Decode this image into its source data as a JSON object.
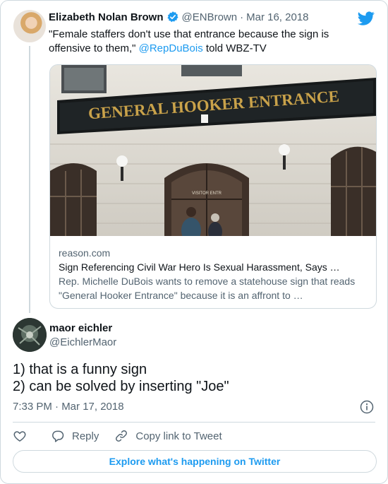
{
  "quoted_tweet": {
    "author_name": "Elizabeth Nolan Brown",
    "author_handle": "@ENBrown",
    "date": "Mar 16, 2018",
    "text_before": "\"Female staffers don't use that entrance because the sign is offensive to them,\" ",
    "mention": "@RepDuBois",
    "text_after": " told WBZ-TV",
    "link_card": {
      "sign_text": "GENERAL HOOKER ENTRANCE",
      "door_text": "VISITOR ENTR",
      "domain": "reason.com",
      "title": "Sign Referencing Civil War Hero Is Sexual Harassment, Says …",
      "description": "Rep. Michelle DuBois wants to remove a statehouse sign that reads \"General Hooker Entrance\" because it is an affront to …"
    }
  },
  "main_tweet": {
    "author_name": "maor eichler",
    "author_handle": "@EichlerMaor",
    "text_lines": [
      "1) that is a funny sign",
      "2) can be solved by inserting \"Joe\""
    ],
    "timestamp": "7:33 PM · Mar 17, 2018"
  },
  "actions": {
    "reply_label": "Reply",
    "copy_label": "Copy link to Tweet"
  },
  "explore_label": "Explore what's happening on Twitter",
  "colors": {
    "accent": "#1d9bf0",
    "text": "#0f1419",
    "secondary_text": "#536471",
    "border": "#cfd9de"
  },
  "icons": [
    "verified-badge-icon",
    "twitter-bird-icon",
    "info-icon",
    "heart-icon",
    "reply-icon",
    "link-icon"
  ]
}
